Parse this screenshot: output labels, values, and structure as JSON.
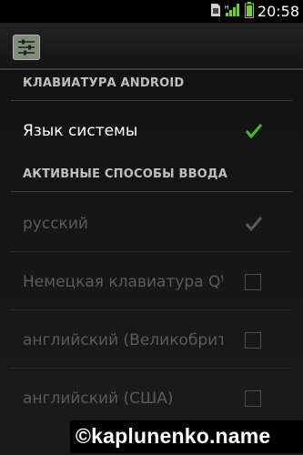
{
  "status_bar": {
    "time": "20:58",
    "icons": [
      "sim-card-icon",
      "signal-icon",
      "battery-icon"
    ]
  },
  "action_bar": {
    "icon": "settings-sliders-icon"
  },
  "sections": {
    "keyboard": {
      "header": "КЛАВИАТУРА ANDROID",
      "rows": [
        {
          "label": "Язык системы",
          "checked": true,
          "enabled": true
        }
      ]
    },
    "active_methods": {
      "header": "АКТИВНЫЕ СПОСОБЫ ВВОДА",
      "rows": [
        {
          "label": "русский",
          "checked": true,
          "enabled": false
        },
        {
          "label": "Немецкая клавиатура QWERTY",
          "checked": false,
          "enabled": false
        },
        {
          "label": "английский (Великобритания)",
          "checked": false,
          "enabled": false
        },
        {
          "label": "английский (США)",
          "checked": false,
          "enabled": false
        }
      ]
    }
  },
  "watermark": "©kaplunenko.name",
  "colors": {
    "accent_check": "#3fbf2a",
    "disabled_check": "#5b5b5b",
    "disabled_text": "#5b5b5b"
  }
}
